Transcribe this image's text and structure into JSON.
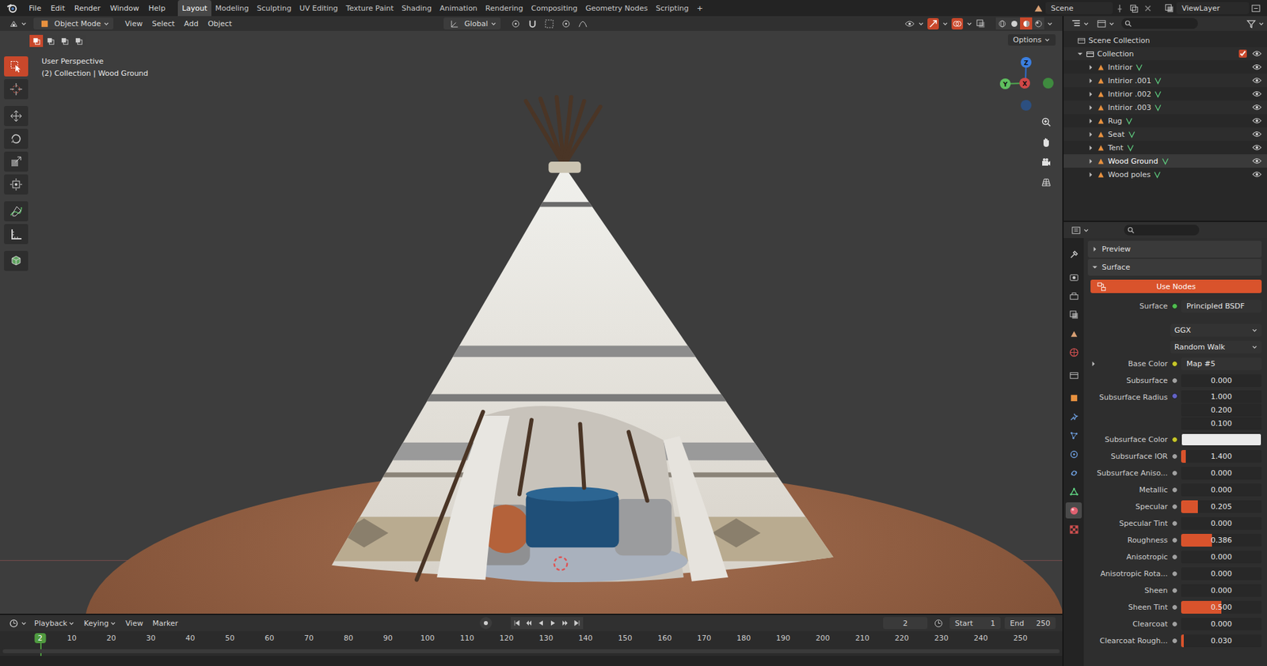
{
  "topbar": {
    "menus": [
      "File",
      "Edit",
      "Render",
      "Window",
      "Help"
    ],
    "workspaces": [
      {
        "label": "Layout",
        "selected": true
      },
      {
        "label": "Modeling",
        "selected": false
      },
      {
        "label": "Sculpting",
        "selected": false
      },
      {
        "label": "UV Editing",
        "selected": false
      },
      {
        "label": "Texture Paint",
        "selected": false
      },
      {
        "label": "Shading",
        "selected": false
      },
      {
        "label": "Animation",
        "selected": false
      },
      {
        "label": "Rendering",
        "selected": false
      },
      {
        "label": "Compositing",
        "selected": false
      },
      {
        "label": "Geometry Nodes",
        "selected": false
      },
      {
        "label": "Scripting",
        "selected": false
      }
    ],
    "add_workspace": "+",
    "scene": "Scene",
    "view_layer": "ViewLayer"
  },
  "viewport": {
    "mode": "Object Mode",
    "menus": [
      "View",
      "Select",
      "Add",
      "Object"
    ],
    "orientation": "Global",
    "options": "Options",
    "view_name": "User Perspective",
    "context": "(2) Collection | Wood Ground",
    "select_modes": [
      {
        "selected": true
      },
      {
        "selected": false
      },
      {
        "selected": false
      },
      {
        "selected": false
      }
    ],
    "tools": [
      {
        "selected": true
      },
      {
        "selected": false
      },
      {
        "selected": false
      },
      {
        "selected": false
      },
      {
        "selected": false
      },
      {
        "selected": false
      },
      {
        "selected": false
      },
      {
        "selected": false
      },
      {
        "selected": false
      }
    ],
    "axes": {
      "x": "X",
      "y": "Y",
      "z": "Z"
    },
    "shading": [
      {
        "selected": false
      },
      {
        "selected": false
      },
      {
        "selected": true
      },
      {
        "selected": false
      }
    ]
  },
  "outliner": {
    "root": "Scene Collection",
    "collection": {
      "name": "Collection",
      "expanded": true,
      "checked": true
    },
    "items": [
      {
        "name": "Intirior",
        "selected": false,
        "visible": true
      },
      {
        "name": "Intirior .001",
        "selected": false,
        "visible": true
      },
      {
        "name": "Intirior .002",
        "selected": false,
        "visible": true
      },
      {
        "name": "Intirior .003",
        "selected": false,
        "visible": true
      },
      {
        "name": "Rug",
        "selected": false,
        "visible": true
      },
      {
        "name": "Seat",
        "selected": false,
        "visible": true
      },
      {
        "name": "Tent",
        "selected": false,
        "visible": true
      },
      {
        "name": "Wood Ground",
        "selected": true,
        "visible": true
      },
      {
        "name": "Wood poles",
        "selected": false,
        "visible": true
      }
    ]
  },
  "properties": {
    "tabs": [
      {
        "selected": false
      },
      {
        "selected": false
      },
      {
        "selected": false
      },
      {
        "selected": false
      },
      {
        "selected": false
      },
      {
        "selected": false
      },
      {
        "selected": false
      },
      {
        "selected": false
      },
      {
        "selected": false
      },
      {
        "selected": false
      },
      {
        "selected": false
      },
      {
        "selected": false
      },
      {
        "selected": false
      },
      {
        "selected": true
      },
      {
        "selected": false
      }
    ],
    "sections": [
      {
        "label": "Preview",
        "expanded": false
      },
      {
        "label": "Surface",
        "expanded": true
      }
    ],
    "use_nodes": "Use Nodes",
    "rows": [
      {
        "kind": "link",
        "label": "Surface",
        "value": "Principled BSDF",
        "socket_color": "#4fbd4f"
      },
      {
        "kind": "dropdown",
        "value": "GGX"
      },
      {
        "kind": "dropdown",
        "value": "Random Walk"
      },
      {
        "kind": "link",
        "label": "Base Color",
        "value": "Map #5",
        "socket_color": "#c7c729",
        "expanded": false
      },
      {
        "kind": "number",
        "label": "Subsurface",
        "value": "0.000",
        "level": 0,
        "socket_color": "#a1a1a1"
      },
      {
        "kind": "vector",
        "label": "Subsurface Radius",
        "values": [
          "1.000",
          "0.200",
          "0.100"
        ],
        "socket_color": "#6363c7"
      },
      {
        "kind": "color",
        "label": "Subsurface Color",
        "color": "#ececec",
        "socket_color": "#c7c729"
      },
      {
        "kind": "number",
        "label": "Subsurface IOR",
        "value": "1.400",
        "level": 0.06,
        "socket_color": "#a1a1a1"
      },
      {
        "kind": "number",
        "label": "Subsurface Aniso...",
        "value": "0.000",
        "level": 0,
        "socket_color": "#a1a1a1"
      },
      {
        "kind": "number",
        "label": "Metallic",
        "value": "0.000",
        "level": 0,
        "socket_color": "#a1a1a1"
      },
      {
        "kind": "number",
        "label": "Specular",
        "value": "0.205",
        "level": 0.205,
        "socket_color": "#a1a1a1"
      },
      {
        "kind": "number",
        "label": "Specular Tint",
        "value": "0.000",
        "level": 0,
        "socket_color": "#a1a1a1"
      },
      {
        "kind": "number",
        "label": "Roughness",
        "value": "0.386",
        "level": 0.386,
        "socket_color": "#a1a1a1"
      },
      {
        "kind": "number",
        "label": "Anisotropic",
        "value": "0.000",
        "level": 0,
        "socket_color": "#a1a1a1"
      },
      {
        "kind": "number",
        "label": "Anisotropic Rota...",
        "value": "0.000",
        "level": 0,
        "socket_color": "#a1a1a1"
      },
      {
        "kind": "number",
        "label": "Sheen",
        "value": "0.000",
        "level": 0,
        "socket_color": "#a1a1a1"
      },
      {
        "kind": "number",
        "label": "Sheen Tint",
        "value": "0.500",
        "level": 0.5,
        "socket_color": "#a1a1a1"
      },
      {
        "kind": "number",
        "label": "Clearcoat",
        "value": "0.000",
        "level": 0,
        "socket_color": "#a1a1a1"
      },
      {
        "kind": "number",
        "label": "Clearcoat Rough...",
        "value": "0.030",
        "level": 0.03,
        "socket_color": "#a1a1a1"
      }
    ]
  },
  "timeline": {
    "menus": [
      "Playback",
      "Keying",
      "View",
      "Marker"
    ],
    "current_frame": "2",
    "start_label": "Start",
    "start": "1",
    "end_label": "End",
    "end": "250",
    "ticks": [
      "10",
      "20",
      "30",
      "40",
      "50",
      "60",
      "70",
      "80",
      "90",
      "100",
      "110",
      "120",
      "130",
      "140",
      "150",
      "160",
      "170",
      "180",
      "190",
      "200",
      "210",
      "220",
      "230",
      "240",
      "250"
    ]
  }
}
